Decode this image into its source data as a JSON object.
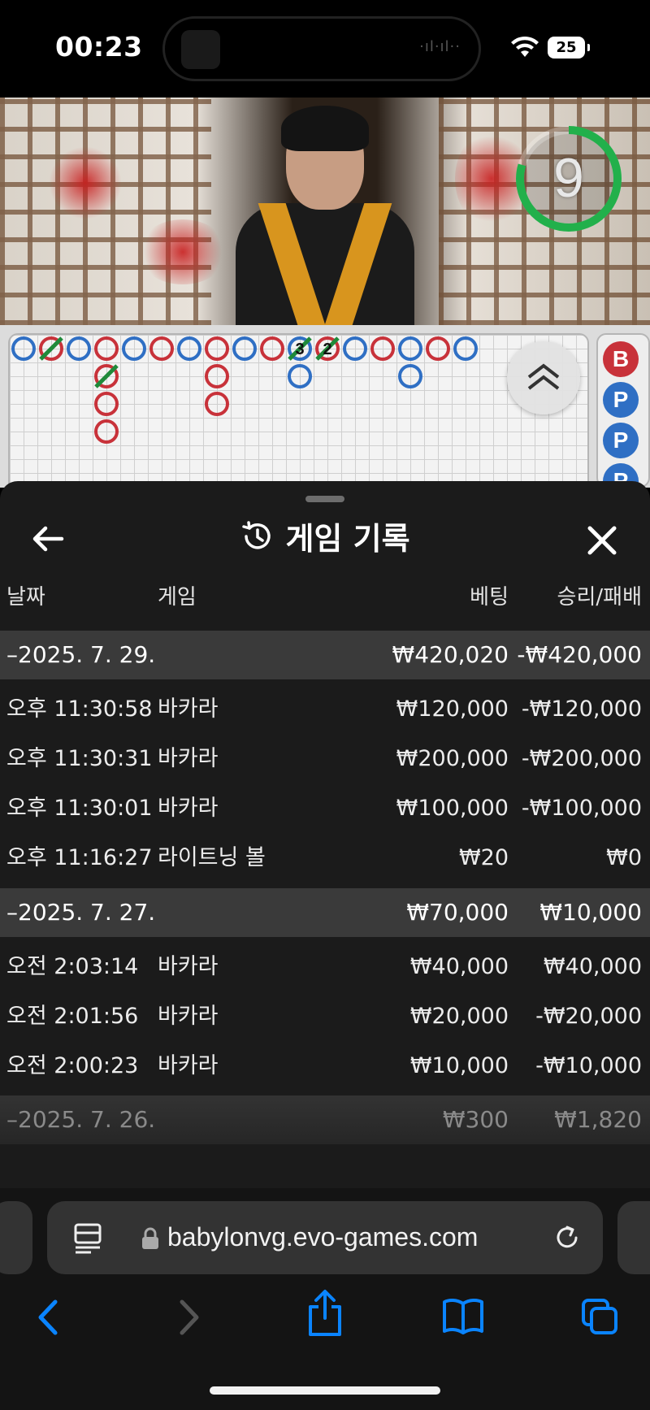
{
  "status_bar": {
    "time": "00:23",
    "battery": "25"
  },
  "video": {
    "countdown": "9"
  },
  "scoreboard": {
    "mini_road": [
      "B",
      "P",
      "P",
      "P"
    ],
    "beads": [
      {
        "col": 0,
        "row": 0,
        "color": "blue"
      },
      {
        "col": 1,
        "row": 0,
        "color": "red",
        "tie": true
      },
      {
        "col": 2,
        "row": 0,
        "color": "blue"
      },
      {
        "col": 3,
        "row": 0,
        "color": "red"
      },
      {
        "col": 3,
        "row": 1,
        "color": "red",
        "tie": true
      },
      {
        "col": 3,
        "row": 2,
        "color": "red"
      },
      {
        "col": 3,
        "row": 3,
        "color": "red"
      },
      {
        "col": 4,
        "row": 0,
        "color": "blue"
      },
      {
        "col": 5,
        "row": 0,
        "color": "red"
      },
      {
        "col": 6,
        "row": 0,
        "color": "blue"
      },
      {
        "col": 7,
        "row": 0,
        "color": "red"
      },
      {
        "col": 7,
        "row": 1,
        "color": "red"
      },
      {
        "col": 7,
        "row": 2,
        "color": "red"
      },
      {
        "col": 8,
        "row": 0,
        "color": "blue"
      },
      {
        "col": 9,
        "row": 0,
        "color": "red"
      },
      {
        "col": 10,
        "row": 0,
        "color": "blue",
        "tie": true,
        "label": "3"
      },
      {
        "col": 10,
        "row": 1,
        "color": "blue"
      },
      {
        "col": 11,
        "row": 0,
        "color": "red",
        "tie": true,
        "label": "2"
      },
      {
        "col": 12,
        "row": 0,
        "color": "blue"
      },
      {
        "col": 13,
        "row": 0,
        "color": "red"
      },
      {
        "col": 14,
        "row": 0,
        "color": "blue"
      },
      {
        "col": 14,
        "row": 1,
        "color": "blue"
      },
      {
        "col": 15,
        "row": 0,
        "color": "red"
      },
      {
        "col": 16,
        "row": 0,
        "color": "blue"
      }
    ]
  },
  "sheet": {
    "title": "게임 기록",
    "columns": {
      "date": "날짜",
      "game": "게임",
      "bet": "베팅",
      "result": "승리/패배"
    },
    "groups": [
      {
        "date": "–2025. 7. 29.",
        "bet": "₩420,020",
        "result": "-₩420,000",
        "rows": [
          {
            "time": "오후 11:30:58",
            "game": "바카라",
            "bet": "₩120,000",
            "result": "-₩120,000"
          },
          {
            "time": "오후 11:30:31",
            "game": "바카라",
            "bet": "₩200,000",
            "result": "-₩200,000"
          },
          {
            "time": "오후 11:30:01",
            "game": "바카라",
            "bet": "₩100,000",
            "result": "-₩100,000"
          },
          {
            "time": "오후 11:16:27",
            "game": "라이트닝 볼",
            "bet": "₩20",
            "result": "₩0"
          }
        ]
      },
      {
        "date": "–2025. 7. 27.",
        "bet": "₩70,000",
        "result": "₩10,000",
        "rows": [
          {
            "time": "오전 2:03:14",
            "game": "바카라",
            "bet": "₩40,000",
            "result": "₩40,000"
          },
          {
            "time": "오전 2:01:56",
            "game": "바카라",
            "bet": "₩20,000",
            "result": "-₩20,000"
          },
          {
            "time": "오전 2:00:23",
            "game": "바카라",
            "bet": "₩10,000",
            "result": "-₩10,000"
          }
        ]
      },
      {
        "date": "–2025. 7. 26.",
        "bet": "₩300",
        "result": "₩1,820",
        "rows": []
      }
    ]
  },
  "browser": {
    "url": "babylonvg.evo-games.com"
  },
  "colors": {
    "banker": "#c8323a",
    "player": "#2f6fc4",
    "tie": "#1f8a3a",
    "timer": "#22b04b",
    "sheet_bg": "#1b1b1b",
    "group_bg": "#3a3a3a",
    "ios_blue": "#0a84ff"
  }
}
